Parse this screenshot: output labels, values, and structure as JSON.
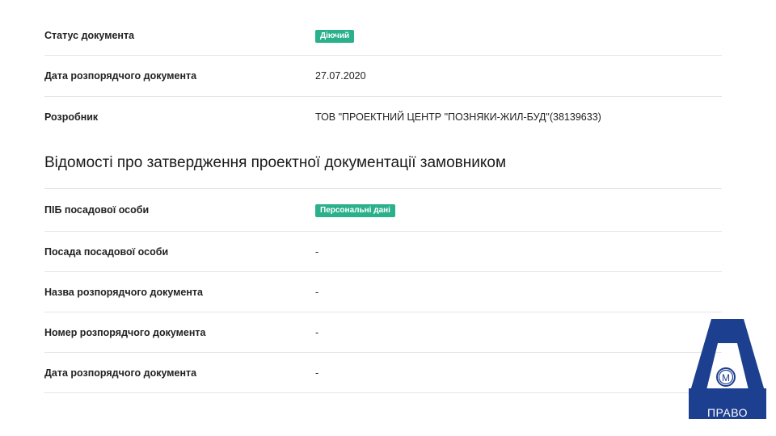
{
  "status": {
    "label": "Статус документа",
    "badge": "Діючий"
  },
  "order_date": {
    "label": "Дата розпорядчого документа",
    "value": "27.07.2020"
  },
  "developer": {
    "label": "Розробник",
    "value": "ТОВ \"ПРОЕКТНИЙ ЦЕНТР \"ПОЗНЯКИ-ЖИЛ-БУД\"(38139633)"
  },
  "approval": {
    "title": "Відомості про затвердження проектної документації замовником",
    "official_name": {
      "label": "ПІБ посадової особи",
      "badge": "Персональні дані"
    },
    "official_position": {
      "label": "Посада посадової особи",
      "value": "-"
    },
    "doc_name": {
      "label": "Назва розпорядчого документа",
      "value": "-"
    },
    "doc_number": {
      "label": "Номер розпорядчого документа",
      "value": "-"
    },
    "doc_date": {
      "label": "Дата розпорядчого документа",
      "value": "-"
    }
  },
  "logo": {
    "mark": "М",
    "text": "ПРАВО"
  },
  "colors": {
    "badge": "#2bb08c",
    "logo": "#1d3f8f",
    "divider": "#e6e6e6"
  }
}
